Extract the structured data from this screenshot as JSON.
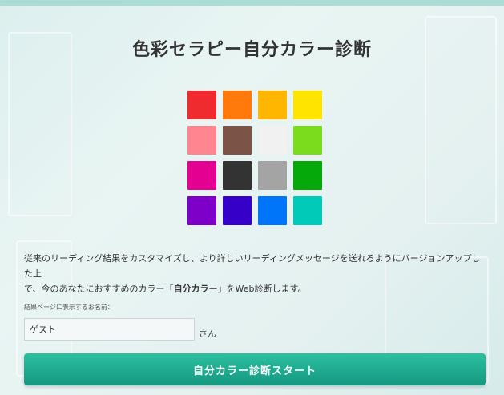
{
  "page": {
    "title": "色彩セラピー自分カラー診断"
  },
  "palette": {
    "colors": [
      "#F02B2F",
      "#FF7A0A",
      "#FFB600",
      "#FFE400",
      "#FF8591",
      "#7B5447",
      "#F1F1F1",
      "#7BDB1D",
      "#E40192",
      "#333333",
      "#A4A4A4",
      "#06A90A",
      "#7E00C8",
      "#3700C9",
      "#0075FA",
      "#02CAB8"
    ]
  },
  "description": {
    "line1": "従来のリーディング結果をカスタマイズし、より詳しいリーディングメッセージを送れるようにバージョンアップした上",
    "line2_prefix": "で、今のあなたにおすすめのカラー「",
    "line2_bold": "自分カラー",
    "line2_suffix": "」をWeb診断します。"
  },
  "form": {
    "name_label": "結果ページに表示するお名前：",
    "name_value": "ゲスト",
    "name_suffix": "さん"
  },
  "actions": {
    "start_label": "自分カラー診断スタート"
  },
  "colors": {
    "button_start": "#2CC0A0",
    "button_end": "#149880",
    "top_strip": "#A9DDD6"
  }
}
